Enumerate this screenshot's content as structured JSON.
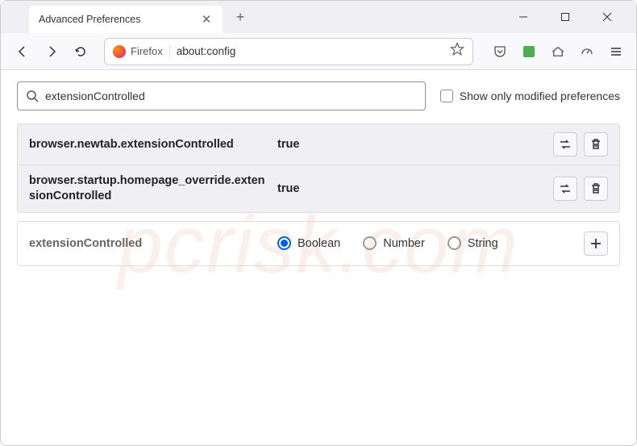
{
  "window": {
    "tab_title": "Advanced Preferences"
  },
  "toolbar": {
    "identity_label": "Firefox",
    "url": "about:config"
  },
  "search": {
    "value": "extensionControlled",
    "checkbox_label": "Show only modified preferences"
  },
  "prefs": [
    {
      "name": "browser.newtab.extensionControlled",
      "value": "true"
    },
    {
      "name": "browser.startup.homepage_override.extensionControlled",
      "value": "true"
    }
  ],
  "add_row": {
    "name": "extensionControlled",
    "types": [
      {
        "label": "Boolean",
        "checked": true
      },
      {
        "label": "Number",
        "checked": false
      },
      {
        "label": "String",
        "checked": false
      }
    ]
  },
  "watermark": "pcrisk.com"
}
